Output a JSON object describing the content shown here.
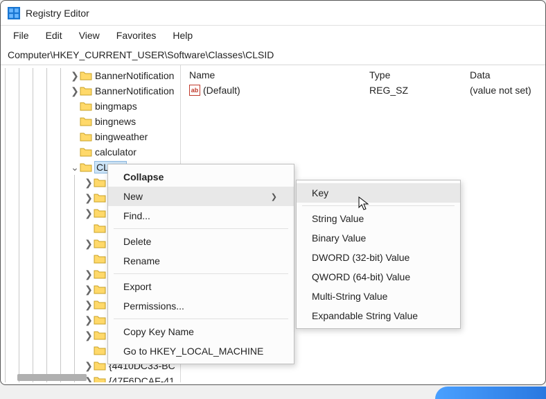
{
  "window": {
    "title": "Registry Editor"
  },
  "menu": {
    "file": "File",
    "edit": "Edit",
    "view": "View",
    "favorites": "Favorites",
    "help": "Help"
  },
  "path": "Computer\\HKEY_CURRENT_USER\\Software\\Classes\\CLSID",
  "tree": {
    "items": [
      {
        "label": "BannerNotification",
        "exp": ">"
      },
      {
        "label": "BannerNotification",
        "exp": ">"
      },
      {
        "label": "bingmaps",
        "exp": ""
      },
      {
        "label": "bingnews",
        "exp": ""
      },
      {
        "label": "bingweather",
        "exp": ""
      },
      {
        "label": "calculator",
        "exp": ""
      },
      {
        "label": "CLSID",
        "exp": "v",
        "selected": true
      },
      {
        "label": "",
        "exp": ">"
      },
      {
        "label": "",
        "exp": ">"
      },
      {
        "label": "",
        "exp": ">"
      },
      {
        "label": "",
        "exp": ""
      },
      {
        "label": "",
        "exp": ">"
      },
      {
        "label": "",
        "exp": ""
      },
      {
        "label": "",
        "exp": ">"
      },
      {
        "label": "",
        "exp": ">"
      },
      {
        "label": "",
        "exp": ">"
      },
      {
        "label": "",
        "exp": ">"
      },
      {
        "label": "",
        "exp": ">"
      },
      {
        "label": "",
        "exp": ""
      },
      {
        "label": "{4410DC33-BC",
        "exp": ">"
      },
      {
        "label": "{47F6DCAF-41",
        "exp": ">"
      }
    ]
  },
  "values": {
    "header": {
      "name": "Name",
      "type": "Type",
      "data": "Data"
    },
    "rows": [
      {
        "name": "(Default)",
        "type": "REG_SZ",
        "data": "(value not set)"
      }
    ]
  },
  "ctx_main": {
    "collapse": "Collapse",
    "new": "New",
    "find": "Find...",
    "del": "Delete",
    "rename": "Rename",
    "export": "Export",
    "perm": "Permissions...",
    "copy": "Copy Key Name",
    "goto": "Go to HKEY_LOCAL_MACHINE"
  },
  "ctx_sub": {
    "key": "Key",
    "string": "String Value",
    "binary": "Binary Value",
    "dword": "DWORD (32-bit) Value",
    "qword": "QWORD (64-bit) Value",
    "multi": "Multi-String Value",
    "expand": "Expandable String Value"
  }
}
